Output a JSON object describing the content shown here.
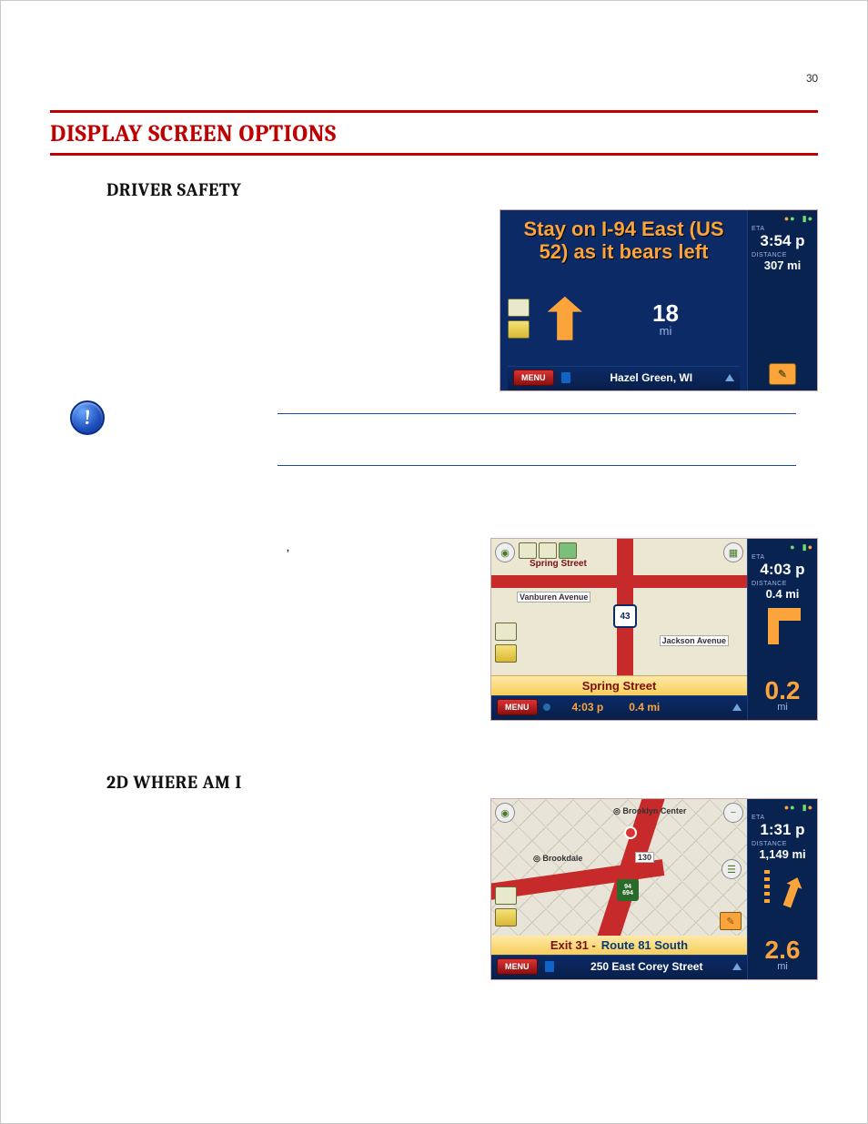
{
  "page_number": "30",
  "section_title": "DISPLAY SCREEN OPTIONS",
  "headings": {
    "driver_safety": "DRIVER SAFETY",
    "where_am_i": "2D WHERE AM I"
  },
  "stray_comma": ",",
  "shot1": {
    "instruction_line1": "Stay on I-94 East (US",
    "instruction_line2": "52) as it bears left",
    "next_dist_num": "18",
    "next_dist_unit": "mi",
    "menu": "MENU",
    "location": "Hazel Green, WI",
    "eta_label": "ETA",
    "eta_value": "3:54 p",
    "dist_label": "DISTANCE",
    "dist_value": "307 mi"
  },
  "shot2": {
    "cross_street_top": "Vanburen Avenue",
    "cross_street_right": "Jackson Avenue",
    "spring_top": "Spring Street",
    "shield": "43",
    "spring_bar": "Spring Street",
    "menu": "MENU",
    "footer_time": "4:03 p",
    "footer_dist": "0.4 mi",
    "eta_label": "ETA",
    "eta_value": "4:03 p",
    "dist_label": "DISTANCE",
    "dist_value": "0.4 mi",
    "side_big": "0.2",
    "side_unit": "mi"
  },
  "shot3": {
    "city1": "Brooklyn Center",
    "city2": "Brookdale",
    "shield_num": "130",
    "badge1": "94",
    "badge2": "694",
    "exit_label": "Exit 31 -",
    "exit_route": "Route 81 South",
    "menu": "MENU",
    "location": "250 East Corey Street",
    "eta_label": "ETA",
    "eta_value": "1:31 p",
    "dist_label": "DISTANCE",
    "dist_value": "1,149 mi",
    "side_big": "2.6",
    "side_unit": "mi"
  }
}
